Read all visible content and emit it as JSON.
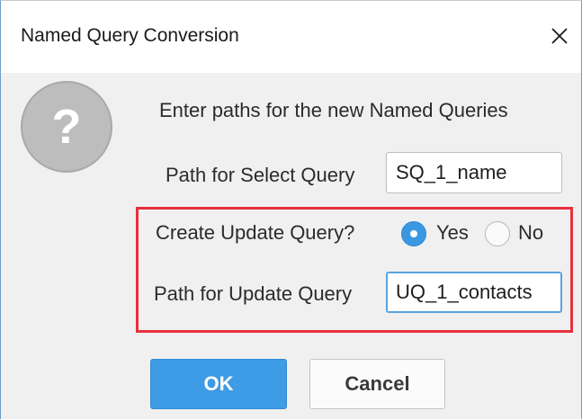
{
  "dialog": {
    "title": "Named Query Conversion",
    "close_icon": "close-icon"
  },
  "message": {
    "icon": "question-icon",
    "icon_glyph": "?",
    "text": "Enter paths for the new Named Queries"
  },
  "select_query": {
    "label": "Path for Select Query",
    "value": "SQ_1_name"
  },
  "update_toggle": {
    "label": "Create Update Query?",
    "options": [
      {
        "label": "Yes",
        "checked": true
      },
      {
        "label": "No",
        "checked": false
      }
    ]
  },
  "update_query": {
    "label": "Path for Update Query",
    "value": "UQ_1_contacts"
  },
  "buttons": {
    "ok": "OK",
    "cancel": "Cancel"
  },
  "colors": {
    "accent": "#3e9be6",
    "highlight": "#e6313c"
  }
}
